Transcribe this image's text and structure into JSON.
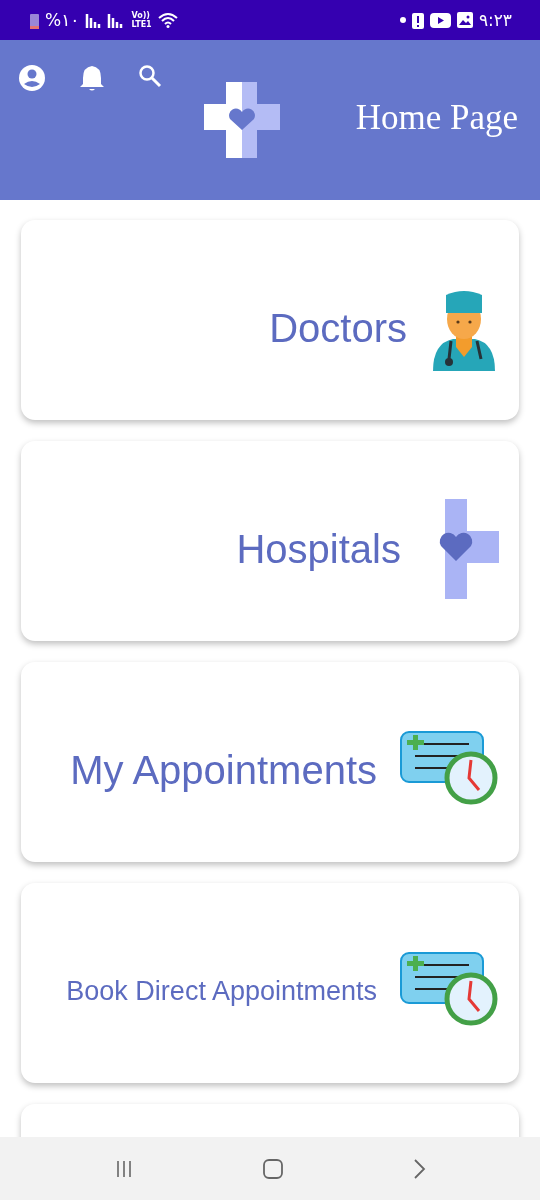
{
  "status_bar": {
    "battery": "%١٠",
    "network": [
      "Vo))",
      "LTE1"
    ],
    "time": "٩:٢٣"
  },
  "header": {
    "title": "Home Page"
  },
  "cards": [
    {
      "kind": "doctor",
      "title": "Doctors"
    },
    {
      "kind": "hospital",
      "title": "Hospitals"
    },
    {
      "kind": "appointment",
      "title": "My Appointments"
    },
    {
      "kind": "appointment",
      "title": "Book Direct Appointments"
    },
    {
      "kind": "blank"
    }
  ]
}
